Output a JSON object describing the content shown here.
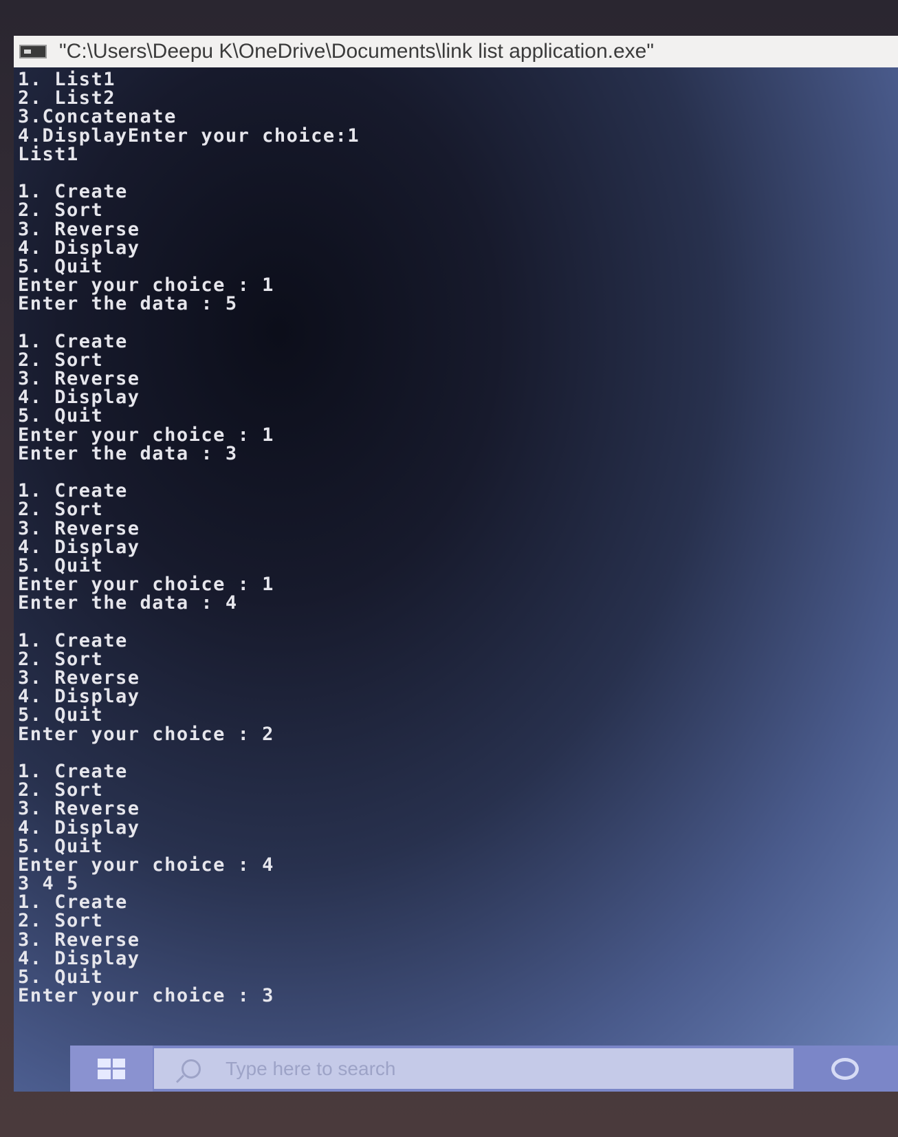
{
  "window": {
    "title": "\"C:\\Users\\Deepu K\\OneDrive\\Documents\\link list application.exe\""
  },
  "console": {
    "lines": [
      "1. List1",
      "2. List2",
      "3.Concatenate",
      "4.DisplayEnter your choice:1",
      "List1",
      "",
      "1. Create",
      "2. Sort",
      "3. Reverse",
      "4. Display",
      "5. Quit",
      "Enter your choice : 1",
      "Enter the data : 5",
      "",
      "1. Create",
      "2. Sort",
      "3. Reverse",
      "4. Display",
      "5. Quit",
      "Enter your choice : 1",
      "Enter the data : 3",
      "",
      "1. Create",
      "2. Sort",
      "3. Reverse",
      "4. Display",
      "5. Quit",
      "Enter your choice : 1",
      "Enter the data : 4",
      "",
      "1. Create",
      "2. Sort",
      "3. Reverse",
      "4. Display",
      "5. Quit",
      "Enter your choice : 2",
      "",
      "1. Create",
      "2. Sort",
      "3. Reverse",
      "4. Display",
      "5. Quit",
      "Enter your choice : 4",
      "3 4 5",
      "1. Create",
      "2. Sort",
      "3. Reverse",
      "4. Display",
      "5. Quit",
      "Enter your choice : 3"
    ]
  },
  "taskbar": {
    "search_placeholder": "Type here to search",
    "start_icon": "windows-logo-icon",
    "search_icon": "search-icon",
    "cortana_icon": "cortana-circle-icon"
  },
  "colors": {
    "console_text": "#e6e6ec",
    "taskbar": "#7b86c8",
    "titlebar": "#f2f1f0"
  }
}
